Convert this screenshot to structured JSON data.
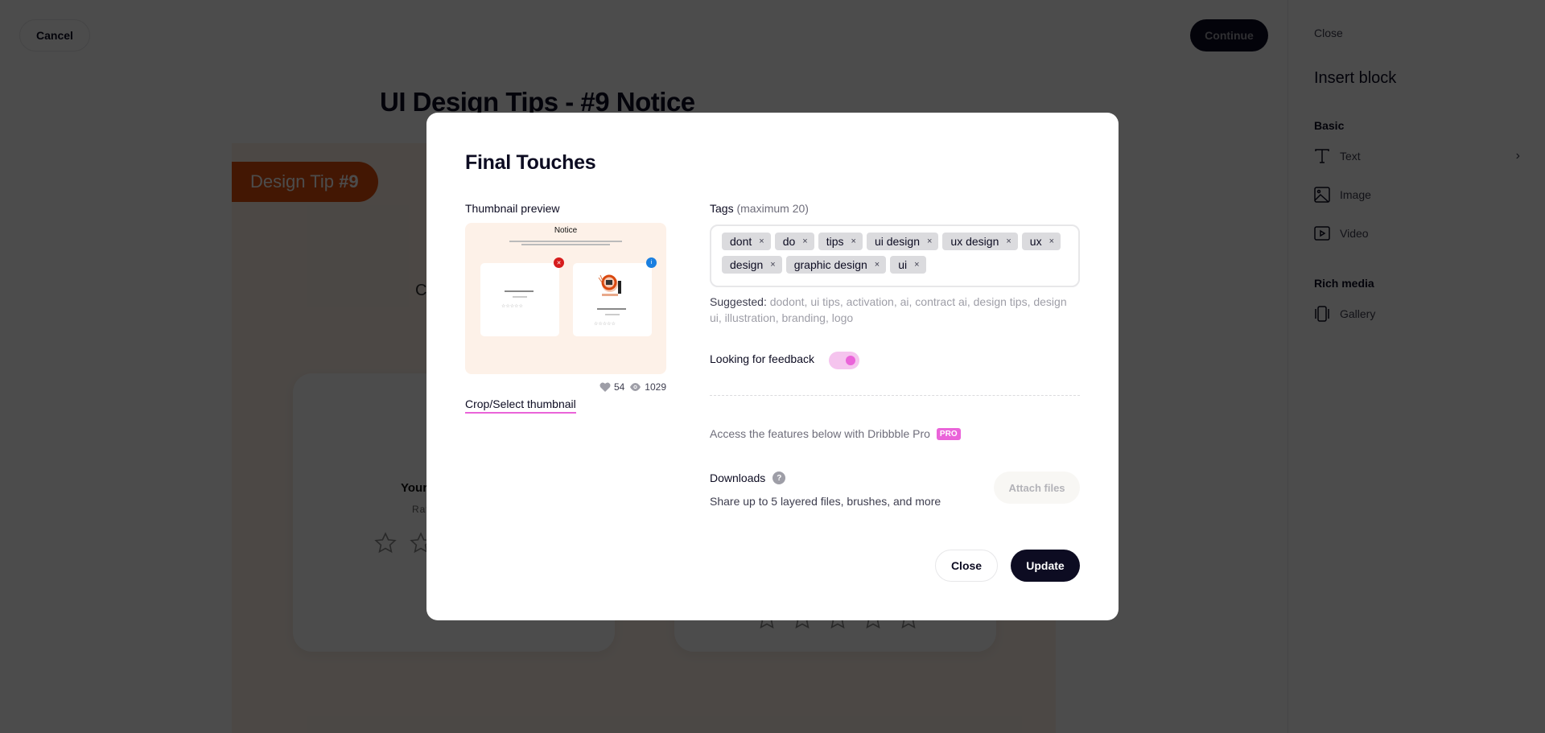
{
  "page": {
    "cancel_label": "Cancel",
    "continue_label": "Continue",
    "shot_title": "UI Design Tips - #9 Notice",
    "canvas": {
      "tip_pill_prefix": "Design Tip ",
      "tip_pill_number": "#9",
      "partial_letter": "C",
      "left_card_heading": "Your",
      "left_card_sub": "Rat",
      "left_card_stars": 5,
      "right_card_stars": 5,
      "accent_color": "#e04f0d",
      "background_color": "#fdf1e8"
    }
  },
  "sidebar": {
    "close_label": "Close",
    "title": "Insert block",
    "sections": [
      {
        "label": "Basic",
        "items": [
          {
            "label": "Text",
            "icon": "text-icon",
            "has_submenu": true
          },
          {
            "label": "Image",
            "icon": "image-icon"
          },
          {
            "label": "Video",
            "icon": "video-icon"
          }
        ]
      },
      {
        "label": "Rich media",
        "items": [
          {
            "label": "Gallery",
            "icon": "gallery-icon"
          }
        ]
      }
    ],
    "chevron": "›"
  },
  "modal": {
    "title": "Final Touches",
    "thumbnail": {
      "label": "Thumbnail preview",
      "preview_title": "Notice",
      "likes": "54",
      "views": "1029",
      "crop_link": "Crop/Select thumbnail"
    },
    "tags": {
      "label": "Tags",
      "hint": "(maximum 20)",
      "items": [
        "dont",
        "do",
        "tips",
        "ui design",
        "ux design",
        "ux",
        "design",
        "graphic design",
        "ui"
      ],
      "remove_glyph": "×"
    },
    "suggested": {
      "label": "Suggested",
      "items": "dodont, ui tips, activation, ai, contract ai, design tips, design ui, illustration, branding, logo"
    },
    "feedback": {
      "label": "Looking for feedback",
      "enabled": true
    },
    "pro": {
      "text": "Access the features below with Dribbble Pro",
      "badge": "PRO",
      "badge_color": "#ea64d9"
    },
    "downloads": {
      "label": "Downloads",
      "help": "?",
      "description": "Share up to 5 layered files, brushes, and more",
      "attach_label": "Attach files"
    },
    "close_label": "Close",
    "update_label": "Update"
  }
}
